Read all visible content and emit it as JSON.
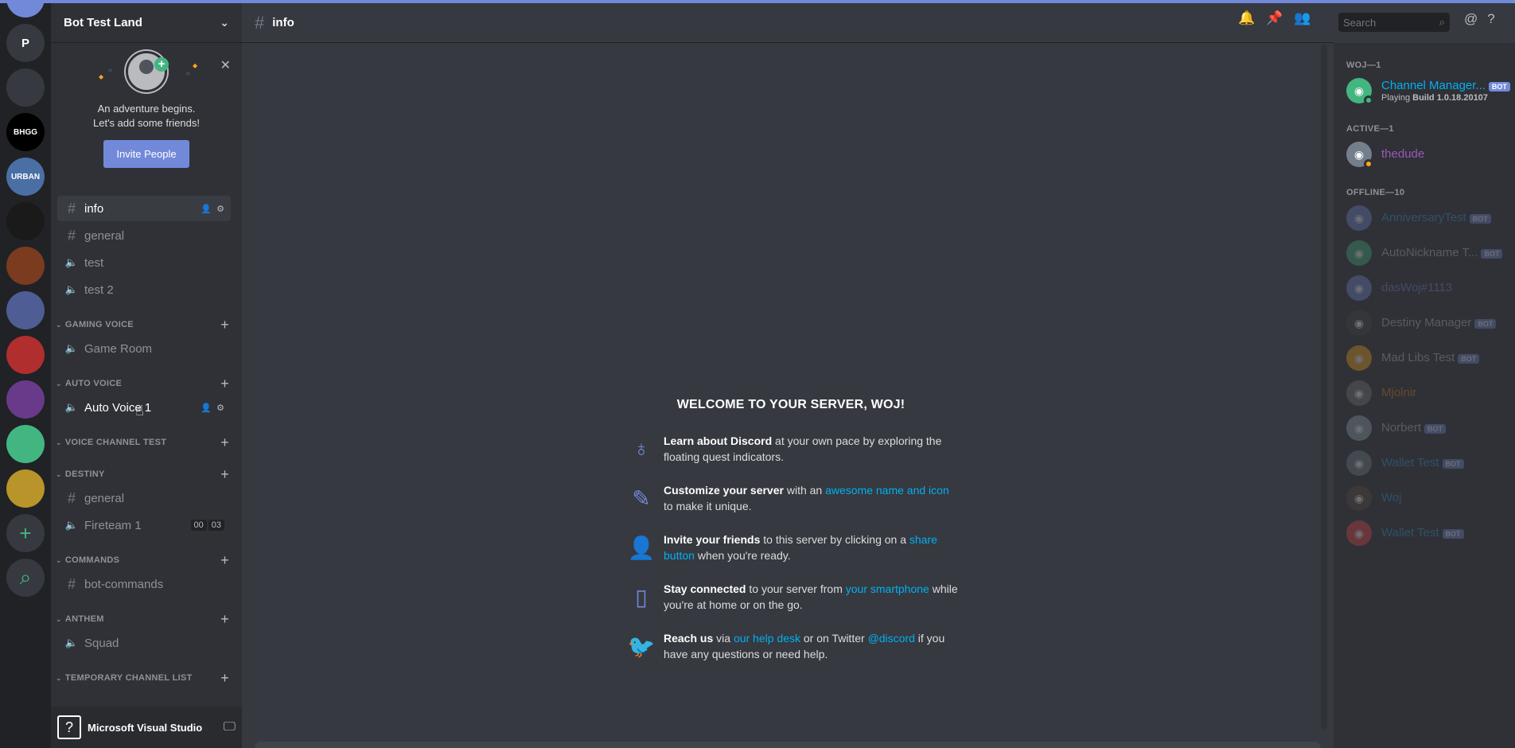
{
  "server": {
    "name": "Bot Test Land"
  },
  "rail": {
    "guilds": [
      {
        "label": "P",
        "color": "#36393f"
      },
      {
        "label": "",
        "color": "#36393f"
      },
      {
        "label": "BHGG",
        "color": "#000000"
      },
      {
        "label": "URBAN",
        "color": "#4a6fa5"
      },
      {
        "label": "",
        "color": "#1a1a1a"
      },
      {
        "label": "",
        "color": "#7a3b1f"
      },
      {
        "label": "",
        "color": "#4e5d94"
      },
      {
        "label": "",
        "color": "#b02e2e"
      },
      {
        "label": "",
        "color": "#6a3a8a"
      },
      {
        "label": "",
        "color": "#43b581"
      },
      {
        "label": "",
        "color": "#b8942a"
      }
    ],
    "add_icon": "+",
    "explore_icon": "⌕"
  },
  "invite": {
    "line1": "An adventure begins.",
    "line2": "Let's add some friends!",
    "button": "Invite People"
  },
  "channels": {
    "top": [
      {
        "name": "info",
        "type": "text",
        "active": true
      },
      {
        "name": "general",
        "type": "text"
      },
      {
        "name": "test",
        "type": "voice"
      },
      {
        "name": "test 2",
        "type": "voice"
      }
    ],
    "categories": [
      {
        "name": "GAMING VOICE",
        "channels": [
          {
            "name": "Game Room",
            "type": "voice"
          }
        ]
      },
      {
        "name": "AUTO VOICE",
        "channels": [
          {
            "name": "Auto Voice 1",
            "type": "voice",
            "hover": true
          }
        ]
      },
      {
        "name": "VOICE CHANNEL TEST",
        "channels": []
      },
      {
        "name": "DESTINY",
        "channels": [
          {
            "name": "general",
            "type": "text"
          },
          {
            "name": "Fireteam 1",
            "type": "voice",
            "tags": [
              "00",
              "03"
            ]
          }
        ]
      },
      {
        "name": "COMMANDS",
        "channels": [
          {
            "name": "bot-commands",
            "type": "text"
          }
        ]
      },
      {
        "name": "ANTHEM",
        "channels": [
          {
            "name": "Squad",
            "type": "voice"
          }
        ]
      },
      {
        "name": "TEMPORARY CHANNEL LIST",
        "channels": []
      }
    ]
  },
  "user_panel": {
    "name": "Microsoft Visual Studio"
  },
  "header": {
    "channel": "info",
    "search_placeholder": "Search"
  },
  "welcome": {
    "title": "WELCOME TO YOUR SERVER, WOJ!",
    "tips": [
      {
        "icon": "quest-icon",
        "bold": "Learn about Discord",
        "text": " at your own pace by exploring the floating quest indicators.",
        "link": "",
        "after": ""
      },
      {
        "icon": "pencil-icon",
        "bold": "Customize your server",
        "text": " with an ",
        "link": "awesome name and icon",
        "after": " to make it unique."
      },
      {
        "icon": "add-friend-icon",
        "bold": "Invite your friends",
        "text": " to this server by clicking on a ",
        "link": "share button",
        "after": " when you're ready."
      },
      {
        "icon": "phone-icon",
        "bold": "Stay connected",
        "text": " to your server from ",
        "link": "your smartphone",
        "after": " while you're at home or on the go."
      },
      {
        "icon": "twitter-icon",
        "bold": "Reach us",
        "text": " via ",
        "link": "our help desk",
        "after": " or on Twitter ",
        "link2": "@discord",
        "after2": " if you have any questions or need help."
      }
    ]
  },
  "members": {
    "groups": [
      {
        "title": "WOJ—1",
        "members": [
          {
            "name": "Channel Manager...",
            "bot": true,
            "activity_pre": "Playing ",
            "activity": "Build 1.0.18.20107",
            "color": "#43b581",
            "name_color": "#00b0f4",
            "status": "#43b581"
          }
        ]
      },
      {
        "title": "ACTIVE—1",
        "members": [
          {
            "name": "thedude",
            "color": "#747f8d",
            "name_color": "#9b59b6",
            "status": "#faa61a"
          }
        ]
      },
      {
        "title": "OFFLINE—10",
        "offline": true,
        "members": [
          {
            "name": "AnniversaryTest",
            "bot": true,
            "color": "#7289da",
            "name_color": "#3498db"
          },
          {
            "name": "AutoNickname T...",
            "bot": true,
            "color": "#43b581",
            "name_color": "#b9bbbe"
          },
          {
            "name": "dasWoj#1113",
            "color": "#7289da",
            "name_color": "#7289da"
          },
          {
            "name": "Destiny Manager",
            "bot": true,
            "color": "#444",
            "name_color": "#b9bbbe"
          },
          {
            "name": "Mad Libs Test",
            "bot": true,
            "color": "#faa61a",
            "name_color": "#b9bbbe"
          },
          {
            "name": "Mjolnir",
            "color": "#777",
            "name_color": "#e67e22"
          },
          {
            "name": "Norbert",
            "bot": true,
            "color": "#99aab5",
            "name_color": "#b9bbbe"
          },
          {
            "name": "Wallet Test",
            "bot": true,
            "color": "#747f8d",
            "name_color": "#3498db"
          },
          {
            "name": "Woj",
            "color": "#5a4a3a",
            "name_color": "#3498db"
          },
          {
            "name": "Wallet Test",
            "bot": true,
            "color": "#f04747",
            "name_color": "#3498db"
          }
        ]
      }
    ],
    "bot_label": "BOT"
  }
}
